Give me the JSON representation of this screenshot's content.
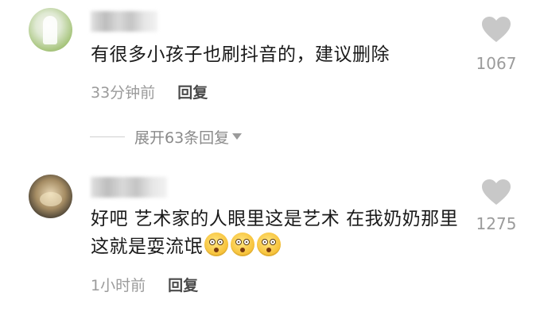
{
  "comments": [
    {
      "text": "有很多小孩子也刷抖音的，建议删除",
      "time": "33分钟前",
      "reply_label": "回复",
      "likes": "1067",
      "expand_label": "展开63条回复"
    },
    {
      "text": "好吧 艺术家的人眼里这是艺术 在我奶奶那里这就是耍流氓",
      "emoji_name": "surprised-face-emoji",
      "emoji_count": 3,
      "time": "1小时前",
      "reply_label": "回复",
      "likes": "1275"
    }
  ],
  "icons": {
    "like": "heart-icon",
    "expand": "triangle-down-icon"
  },
  "colors": {
    "text": "#1a1a1a",
    "meta": "#9b9b9b",
    "heart": "#c8c8c8",
    "background": "#ffffff"
  }
}
